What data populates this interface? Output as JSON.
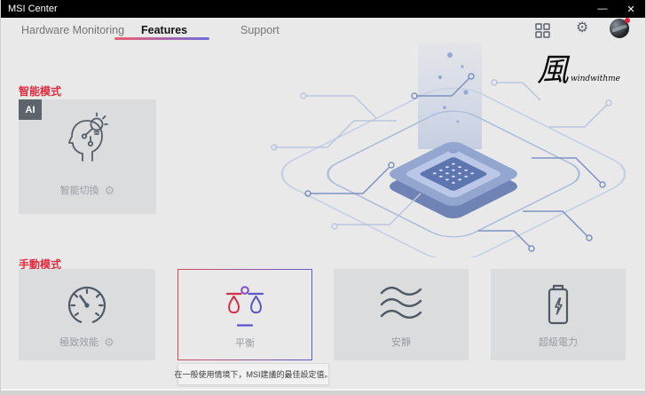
{
  "window": {
    "title": "MSI Center"
  },
  "icons": {
    "minimize": "—",
    "close": "✕",
    "gear": "⚙"
  },
  "nav": {
    "tabs": [
      {
        "label": "Hardware Monitoring",
        "active": false
      },
      {
        "label": "Features",
        "active": true
      },
      {
        "label": "Support",
        "active": false
      }
    ]
  },
  "watermark": {
    "glyph": "風",
    "text": "windwithme"
  },
  "smart": {
    "title": "智能模式",
    "card": {
      "badge": "AI",
      "label": "智能切換",
      "icon": "head-lightbulb-icon",
      "has_settings_gear": true
    }
  },
  "manual": {
    "title": "手動模式",
    "cards": [
      {
        "label": "極致效能",
        "icon": "gauge-icon",
        "selected": false,
        "has_settings_gear": true
      },
      {
        "label": "平衡",
        "icon": "balance-scale-icon",
        "selected": true,
        "has_settings_gear": false
      },
      {
        "label": "安靜",
        "icon": "waves-icon",
        "selected": false,
        "has_settings_gear": false
      },
      {
        "label": "超級電力",
        "icon": "battery-bolt-icon",
        "selected": false,
        "has_settings_gear": false
      }
    ]
  },
  "tooltip": {
    "text": "在一般使用情境下，MSI建議的最佳設定值。"
  },
  "colors": {
    "titlebar_bg": "#000000",
    "page_bg": "#e9e9e9",
    "card_bg": "#dbdcde",
    "accent_red": "#e02b3f",
    "underline_start": "#ee5f72",
    "underline_end": "#6e6fd8",
    "selected_border_start": "#d94a5c",
    "selected_border_end": "#5a5fd0",
    "icon_stroke": "#4f5a64",
    "notification_dot": "#e5243b"
  }
}
